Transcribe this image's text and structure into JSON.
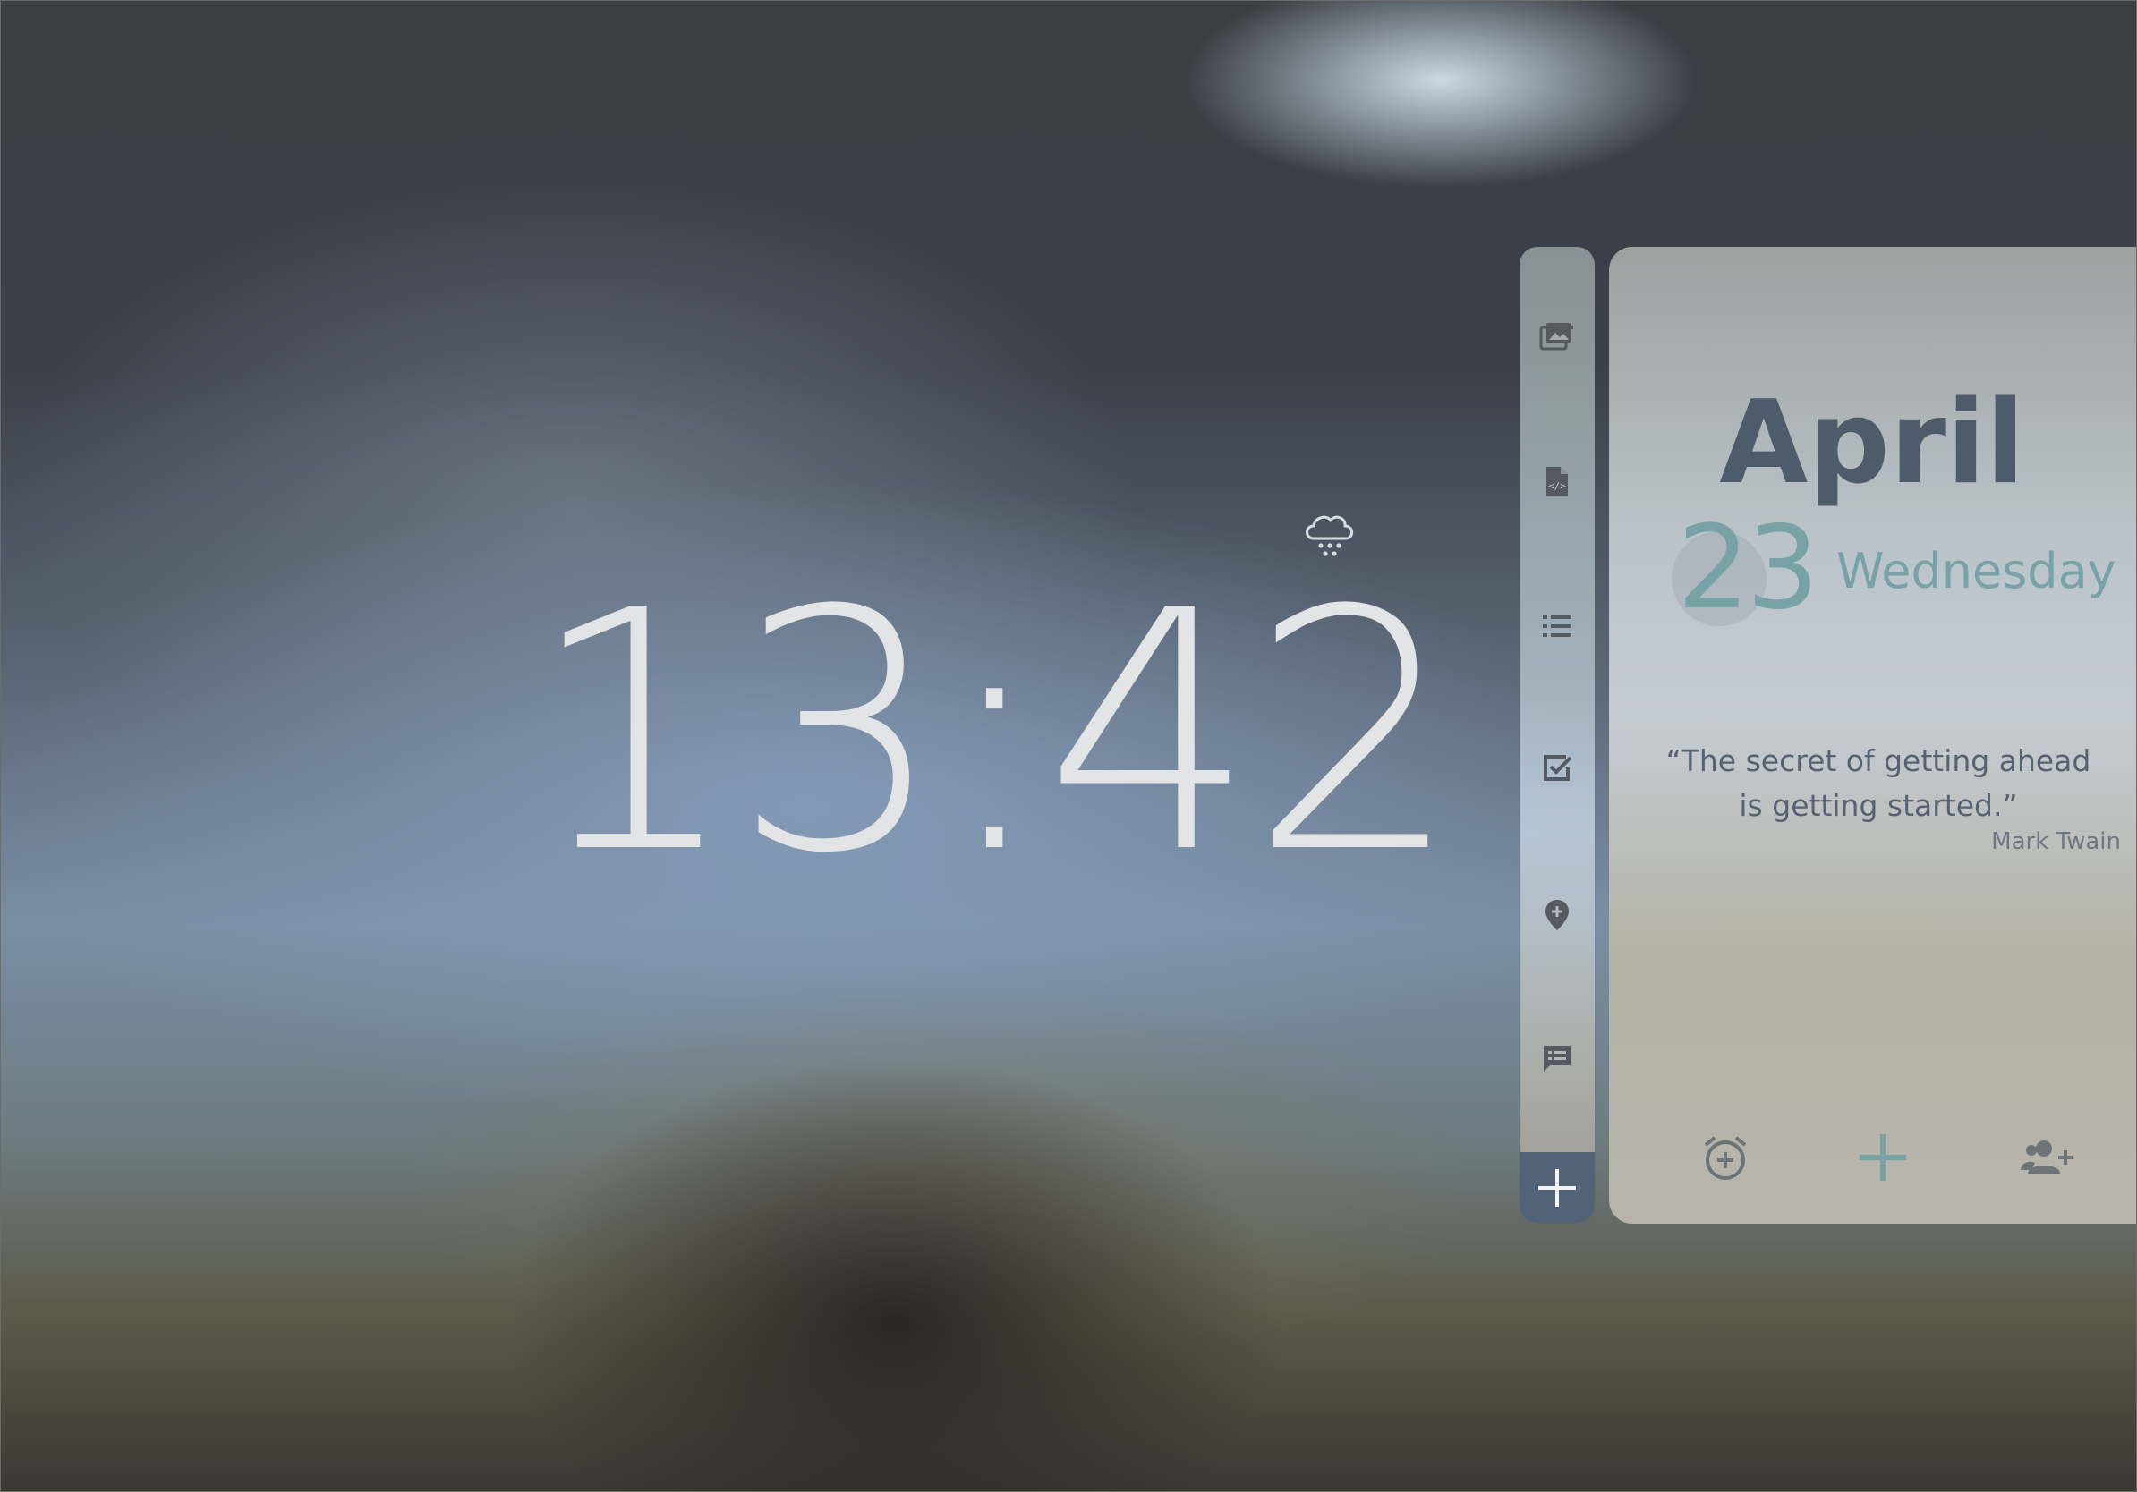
{
  "clock": {
    "time": "13:42"
  },
  "weather": {
    "icon": "snow-cloud-icon"
  },
  "sidebar": {
    "items": [
      {
        "icon": "gallery-icon"
      },
      {
        "icon": "code-file-icon"
      },
      {
        "icon": "list-icon"
      },
      {
        "icon": "checkbox-icon"
      },
      {
        "icon": "add-location-icon"
      },
      {
        "icon": "message-icon"
      }
    ],
    "add_icon": "plus-icon"
  },
  "calendar": {
    "month": "April",
    "day": "23",
    "weekday": "Wednesday"
  },
  "quote": {
    "text": "“The secret of getting ahead is getting started.”",
    "author": "Mark Twain"
  },
  "panel_actions": [
    {
      "icon": "add-alarm-icon"
    },
    {
      "icon": "plus-icon"
    },
    {
      "icon": "add-person-icon"
    }
  ],
  "colors": {
    "accent_teal": "#78a2a6",
    "month_slate": "#4d5b6b",
    "add_button_bg": "#526378",
    "clock_text": "#e3e4e6"
  }
}
